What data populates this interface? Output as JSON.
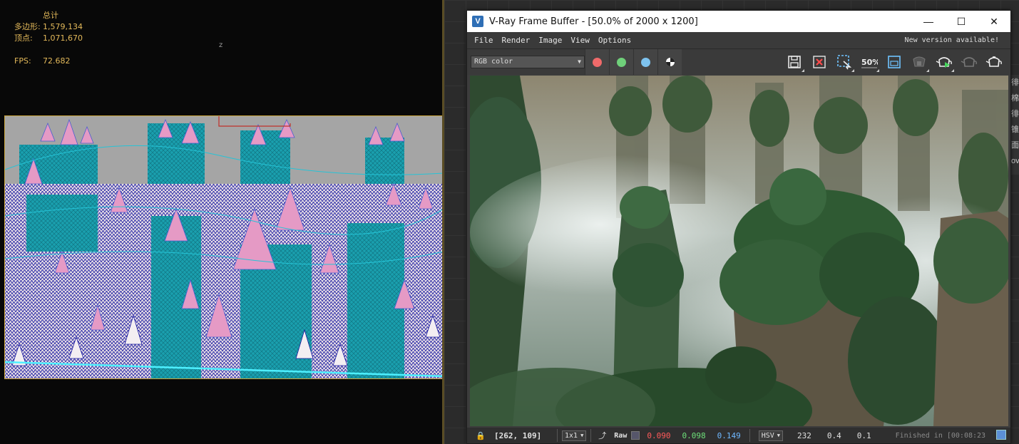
{
  "viewport": {
    "stats_title": "总计",
    "polygons_label": "多边形:",
    "polygons_value": "1,579,134",
    "vertices_label": "顶点:",
    "vertices_value": "1,071,670",
    "fps_label": "FPS:",
    "fps_value": "72.682",
    "axis_label": "z"
  },
  "vfb": {
    "title": "V-Ray Frame Buffer - [50.0% of 2000 x 1200]",
    "icon_letter": "V",
    "window_buttons": {
      "minimize": "—",
      "maximize": "☐",
      "close": "✕"
    },
    "menu": [
      "File",
      "Render",
      "Image",
      "View",
      "Options"
    ],
    "new_version": "New version available!",
    "channel": "RGB color",
    "channel_colors": {
      "red": "#f06a6a",
      "green": "#6fd07a",
      "blue": "#7ec3ef"
    },
    "toolbar_icons": [
      "save-icon",
      "clear-image-icon",
      "region-render-icon",
      "zoom-50-icon",
      "link-viewport-icon",
      "stop-render-icon",
      "render-teapot-icon",
      "interactive-render-icon",
      "render-last-icon"
    ],
    "zoom_label": "50%",
    "status": {
      "coords": "[262, 109]",
      "sample_size": "1x1",
      "raw_label": "Raw",
      "r": "0.090",
      "g": "0.098",
      "b": "0.149",
      "color_space": "HSV",
      "h": "232",
      "s": "0.4",
      "v": "0.1",
      "finished": "Finished in [00:08:23"
    }
  },
  "side_glyphs": [
    "徘",
    "棉",
    "徘",
    "锥",
    "面",
    "ov"
  ]
}
